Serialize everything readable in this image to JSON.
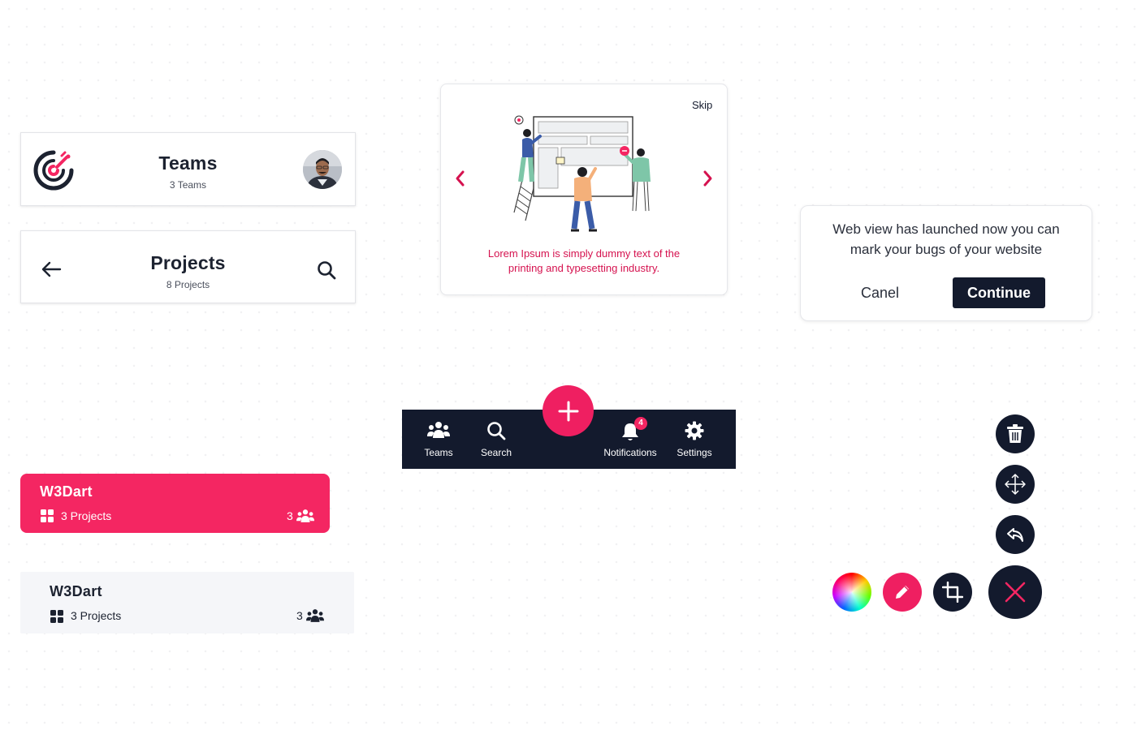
{
  "teams_header": {
    "title": "Teams",
    "subtitle": "3 Teams",
    "logo_icon": "target-logo-icon",
    "avatar": "user-avatar"
  },
  "projects_header": {
    "title": "Projects",
    "subtitle": "8 Projects",
    "back_icon": "arrow-left-icon",
    "search_icon": "search-icon"
  },
  "onboarding": {
    "skip_label": "Skip",
    "caption": "Lorem Ipsum is simply dummy text of the printing and typesetting industry.",
    "prev_icon": "chevron-left-icon",
    "next_icon": "chevron-right-icon"
  },
  "dialog": {
    "message": "Web view has launched now you can mark your bugs of your website",
    "cancel_label": "Canel",
    "continue_label": "Continue"
  },
  "bottom_nav": {
    "items": [
      {
        "label": "Teams",
        "icon": "people-icon"
      },
      {
        "label": "Search",
        "icon": "search-icon"
      },
      {
        "label": "Notifications",
        "icon": "bell-icon",
        "badge": "4"
      },
      {
        "label": "Settings",
        "icon": "gear-icon"
      }
    ],
    "fab_icon": "plus-icon"
  },
  "team_cards": [
    {
      "name": "W3Dart",
      "projects": "3 Projects",
      "members": "3",
      "style": "pink"
    },
    {
      "name": "W3Dart",
      "projects": "3 Projects",
      "members": "3",
      "style": "light"
    }
  ],
  "tools": {
    "vertical": [
      "trash-icon",
      "move-icon",
      "undo-icon"
    ],
    "horizontal": [
      "color-wheel-icon",
      "pencil-icon",
      "crop-icon"
    ],
    "close_icon": "close-icon"
  },
  "colors": {
    "accent": "#f42662",
    "dark": "#131a2d",
    "chevron": "#d5124f"
  }
}
